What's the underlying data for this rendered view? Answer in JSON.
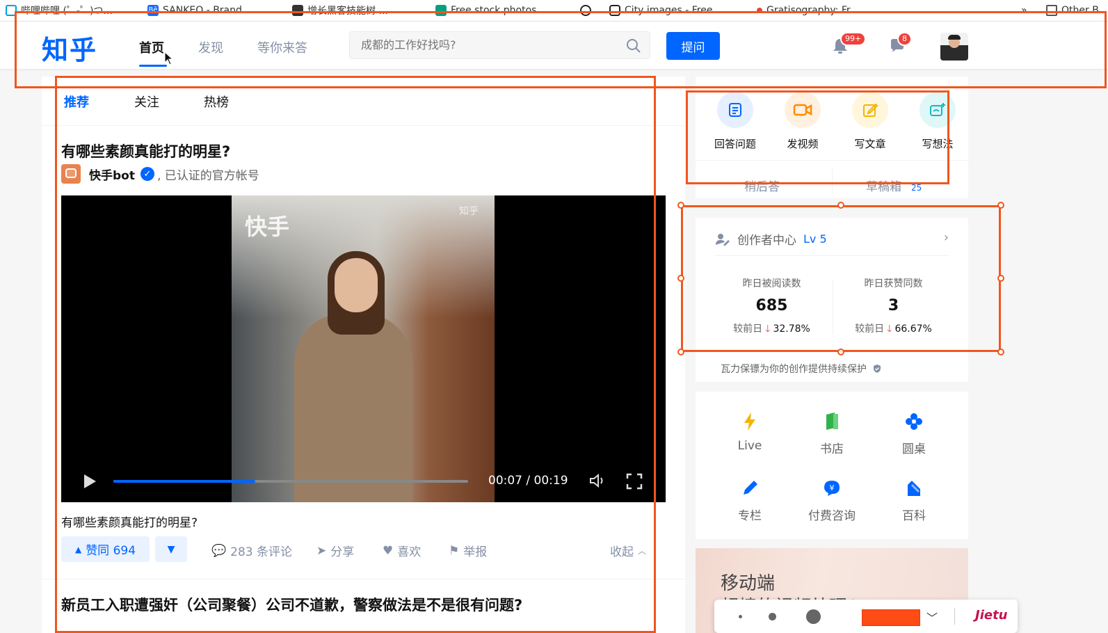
{
  "bookmarks": [
    {
      "label": "哔哩哔哩 (゜-゜)つ...",
      "icon": "bilibili-icon",
      "color": "#00a1d6"
    },
    {
      "label": "SANKEO - Brand...",
      "icon": "behance-icon",
      "color": "#1769ff"
    },
    {
      "label": "增长黑客技能树 ...",
      "icon": "hacker-icon",
      "color": "#333333"
    },
    {
      "label": "Free stock photos...",
      "icon": "photo-icon",
      "color": "#05a081"
    },
    {
      "label": "",
      "icon": "globe-icon",
      "color": "#222222"
    },
    {
      "label": "City images - Free...",
      "icon": "camera-icon",
      "color": "#222222"
    },
    {
      "label": "Gratisography: Fr...",
      "icon": "dot-icon",
      "color": "#e0443e"
    }
  ],
  "bookmarks_more": "»",
  "bookmarks_other": "Other B",
  "header": {
    "logo": "知乎",
    "nav": [
      "首页",
      "发现",
      "等你来答"
    ],
    "search_placeholder": "成都的工作好找吗?",
    "ask_button": "提问",
    "notifications_count": "99+",
    "messages_count": "8"
  },
  "feed": {
    "tabs": [
      "推荐",
      "关注",
      "热榜"
    ],
    "question_title": "有哪些素颜真能打的明星?",
    "author_name": "快手bot",
    "author_desc": ", 已认证的官方帐号",
    "video": {
      "watermark": "快手",
      "watermark_small": "知乎",
      "time": "00:07 / 00:19",
      "progress": 0.4
    },
    "caption": "有哪些素颜真能打的明星?",
    "actions": {
      "vote_up": "赞同 694",
      "comments": "283 条评论",
      "share": "分享",
      "like": "喜欢",
      "report": "举报",
      "collapse": "收起"
    },
    "next_title": "新员工入职遭强奸（公司聚餐）公司不道歉，警察做法是不是很有问题?"
  },
  "create": {
    "items": [
      {
        "label": "回答问题",
        "icon": "answer-icon",
        "color": "#0066ff",
        "bg": "#e5efff"
      },
      {
        "label": "发视频",
        "icon": "video-icon",
        "color": "#ff8a00",
        "bg": "#fff0e0"
      },
      {
        "label": "写文章",
        "icon": "edit-icon",
        "color": "#f5b400",
        "bg": "#fff6dc"
      },
      {
        "label": "写想法",
        "icon": "idea-icon",
        "color": "#12b7c5",
        "bg": "#e0f7f8"
      }
    ],
    "later_answer": "稍后答",
    "drafts": "草稿箱",
    "drafts_count": "25"
  },
  "creator": {
    "title": "创作者中心",
    "level": "Lv 5",
    "stats": [
      {
        "label": "昨日被阅读数",
        "value": "685",
        "compare": "较前日",
        "change": "32.78%"
      },
      {
        "label": "昨日获赞同数",
        "value": "3",
        "compare": "较前日",
        "change": "66.67%"
      }
    ],
    "protect": "瓦力保镖为你的创作提供持续保护"
  },
  "tools": [
    {
      "label": "Live",
      "icon": "lightning-icon",
      "color": "#f5b400"
    },
    {
      "label": "书店",
      "icon": "book-icon",
      "color": "#2fb34a"
    },
    {
      "label": "圆桌",
      "icon": "roundtable-icon",
      "color": "#0066ff"
    },
    {
      "label": "专栏",
      "icon": "pen-icon",
      "color": "#0066ff"
    },
    {
      "label": "付费咨询",
      "icon": "consult-icon",
      "color": "#0066ff"
    },
    {
      "label": "百科",
      "icon": "wiki-icon",
      "color": "#0066ff"
    }
  ],
  "promo": {
    "title": "移动端",
    "subtitle": "超棒的视频处理SDK"
  },
  "jietu": {
    "logo": "Jietu",
    "accent": "#ff4b14"
  },
  "annotation_color": "#f0561d"
}
